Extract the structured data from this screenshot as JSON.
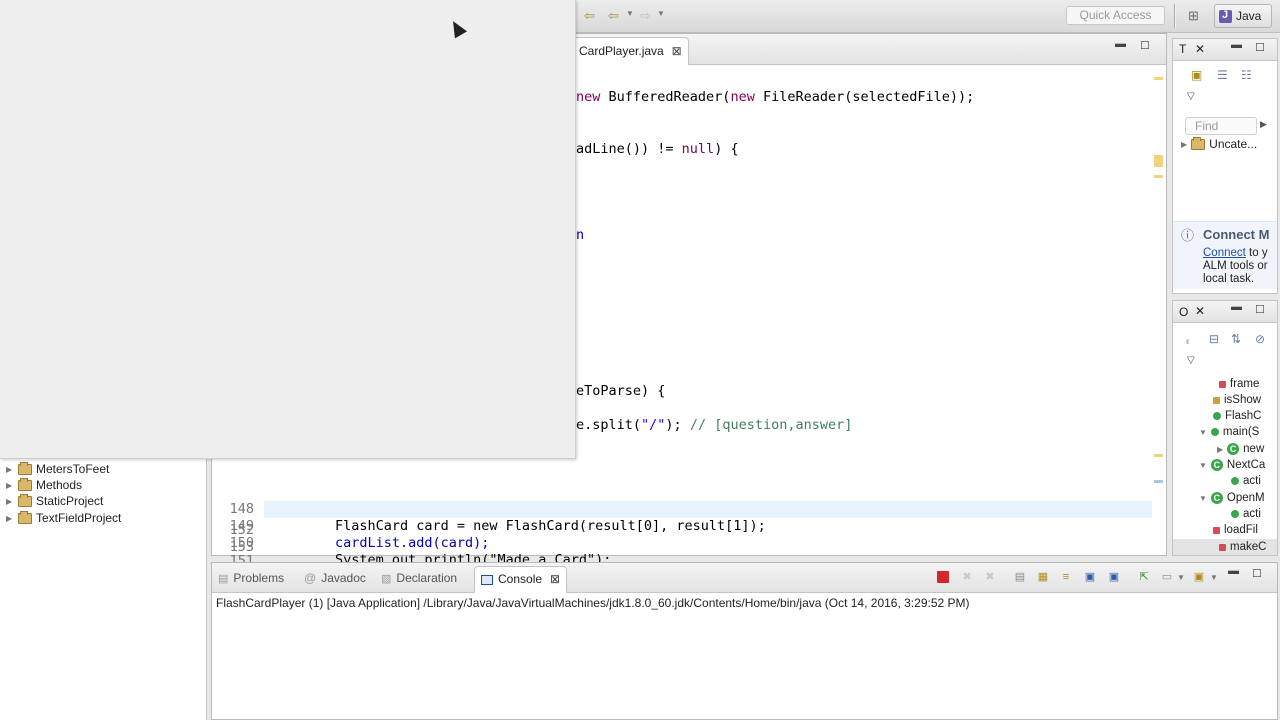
{
  "toolbar": {
    "quick_access_placeholder": "Quick Access",
    "perspective_label": "Java",
    "icons": [
      "back-arrow-icon",
      "back-history-icon",
      "forward-arrow-icon",
      "open-perspective-icon"
    ]
  },
  "editor": {
    "tab_label": "CardPlayer.java",
    "visible_code": [
      {
        "text_parts": [
          [
            "kw",
            "new"
          ],
          [
            "",
            " BufferedReader("
          ],
          [
            "kw",
            "new"
          ],
          [
            "",
            " FileReader(selectedFile));"
          ]
        ]
      },
      {
        "text_parts": [
          [
            "",
            "adLine()) != "
          ],
          [
            "kw",
            "null"
          ],
          [
            "",
            ") {"
          ]
        ]
      },
      {
        "text_parts": [
          [
            "",
            "n"
          ]
        ]
      },
      {
        "text_parts": [
          [
            "",
            "eToParse) {"
          ]
        ]
      },
      {
        "text_parts": [
          [
            "",
            "e.split("
          ],
          [
            "str",
            "\"/\""
          ],
          [
            "",
            "); "
          ],
          [
            "cmt",
            "// [question,answer]"
          ]
        ]
      }
    ],
    "numbered_lines": [
      {
        "num": "148",
        "code": "FlashCard card = new FlashCard(result[0], result[1]);"
      },
      {
        "num": "149",
        "code": "cardList.add(card);"
      },
      {
        "num": "150",
        "code": "System.out.println(\"Made a Card\");"
      },
      {
        "num": "151",
        "code": ""
      },
      {
        "num": "152",
        "code": ""
      },
      {
        "num": "153",
        "code": ""
      }
    ]
  },
  "package_explorer": {
    "items": [
      "MetersToFeet",
      "Methods",
      "StaticProject",
      "TextFieldProject"
    ]
  },
  "task_view": {
    "tab_label": "T",
    "find_placeholder": "Find",
    "uncategorized_label": "Uncate...",
    "connect_title": "Connect M",
    "connect_link": "Connect",
    "connect_text_1": " to y",
    "connect_text_2": "ALM tools or",
    "connect_text_3": "local task."
  },
  "outline_view": {
    "tab_label": "O",
    "items": [
      {
        "label": "frame",
        "kind": "field-private"
      },
      {
        "label": "isShow",
        "kind": "field-private-static"
      },
      {
        "label": "FlashC",
        "kind": "constructor"
      },
      {
        "label": "main(S",
        "kind": "method-static"
      },
      {
        "label": "new",
        "kind": "anon-class"
      },
      {
        "label": "NextCa",
        "kind": "inner-class"
      },
      {
        "label": "acti",
        "kind": "method"
      },
      {
        "label": "OpenM",
        "kind": "inner-class"
      },
      {
        "label": "acti",
        "kind": "method"
      },
      {
        "label": "loadFil",
        "kind": "method-private"
      },
      {
        "label": "makeC",
        "kind": "method-private"
      }
    ]
  },
  "console": {
    "tabs": [
      {
        "label": "Problems",
        "icon": "problems-icon"
      },
      {
        "label": "Javadoc",
        "icon": "javadoc-icon"
      },
      {
        "label": "Declaration",
        "icon": "declaration-icon"
      }
    ],
    "active_tab_label": "Console",
    "status": "FlashCardPlayer (1) [Java Application] /Library/Java/JavaVirtualMachines/jdk1.8.0_60.jdk/Contents/Home/bin/java (Oct 14, 2016, 3:29:52 PM)"
  },
  "colors": {
    "keyword": "#7f0055",
    "string": "#2a00ff",
    "comment": "#3f7f5f",
    "field": "#0000c0",
    "terminate_button": "#d3272c"
  }
}
